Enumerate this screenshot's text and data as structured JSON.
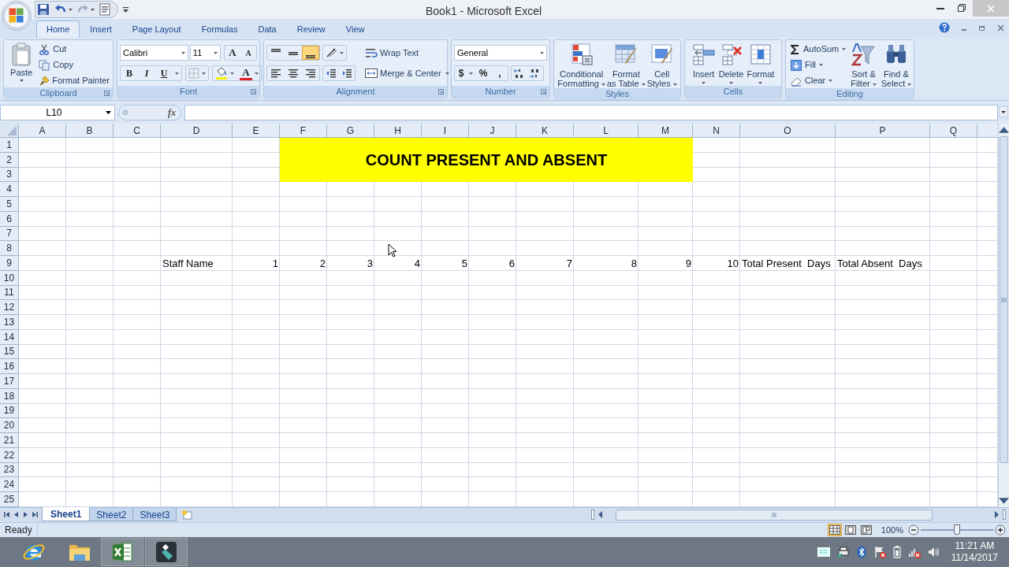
{
  "window": {
    "title": "Book1 - Microsoft Excel"
  },
  "tabs": [
    {
      "label": "Home",
      "selected": true
    },
    {
      "label": "Insert",
      "selected": false
    },
    {
      "label": "Page Layout",
      "selected": false
    },
    {
      "label": "Formulas",
      "selected": false
    },
    {
      "label": "Data",
      "selected": false
    },
    {
      "label": "Review",
      "selected": false
    },
    {
      "label": "View",
      "selected": false
    }
  ],
  "ribbon": {
    "clipboard": {
      "title": "Clipboard",
      "paste": [
        "Paste"
      ],
      "cut": "Cut",
      "copy": "Copy",
      "format_painter": "Format Painter"
    },
    "font": {
      "title": "Font",
      "font_name": "Calibri",
      "font_size": "11",
      "grow": "A",
      "shrink": "A",
      "bold": "B",
      "italic": "I",
      "underline": "U",
      "font_color": "A"
    },
    "alignment": {
      "title": "Alignment",
      "vertical_align": [
        {
          "selected": false
        },
        {
          "selected": false
        },
        {
          "selected": true
        }
      ],
      "wrap_text": "Wrap Text",
      "merge_center": "Merge & Center"
    },
    "number": {
      "title": "Number",
      "format": "General",
      "currency": "$",
      "percent": "%",
      "comma": ","
    },
    "styles": {
      "title": "Styles",
      "conditional_formatting": [
        "Conditional",
        "Formatting"
      ],
      "format_as_table": [
        "Format",
        "as Table"
      ],
      "cell_styles": [
        "Cell",
        "Styles"
      ]
    },
    "cells": {
      "title": "Cells",
      "insert": [
        "Insert"
      ],
      "delete": [
        "Delete"
      ],
      "format": [
        "Format"
      ]
    },
    "editing": {
      "title": "Editing",
      "autosum": "AutoSum",
      "fill": "Fill",
      "clear": "Clear",
      "sort_filter": [
        "Sort &",
        "Filter"
      ],
      "find_select": [
        "Find &",
        "Select"
      ]
    }
  },
  "formula_bar": {
    "name_box": "L10",
    "function_button": "fx"
  },
  "sheet": {
    "columns": [
      "A",
      "B",
      "C",
      "D",
      "E",
      "F",
      "G",
      "H",
      "I",
      "J",
      "K",
      "L",
      "M",
      "N",
      "O",
      "P",
      "Q"
    ],
    "title_banner": {
      "text": "COUNT PRESENT AND ABSENT"
    },
    "rows": [
      {
        "header": "1"
      },
      {
        "header": "2"
      },
      {
        "header": "3"
      },
      {
        "header": "4"
      },
      {
        "header": "5"
      },
      {
        "header": "6"
      },
      {
        "header": "7"
      },
      {
        "header": "8"
      },
      {
        "header": "9",
        "cells": [
          {
            "text": "Staff Name",
            "kind": "text"
          },
          {
            "text": "1",
            "kind": "number"
          },
          {
            "text": "2",
            "kind": "number"
          },
          {
            "text": "3",
            "kind": "number"
          },
          {
            "text": "4",
            "kind": "number"
          },
          {
            "text": "5",
            "kind": "number"
          },
          {
            "text": "6",
            "kind": "number"
          },
          {
            "text": "7",
            "kind": "number"
          },
          {
            "text": "8",
            "kind": "number"
          },
          {
            "text": "9",
            "kind": "number"
          },
          {
            "text": "10",
            "kind": "number"
          },
          {
            "text": "Total Present  Days",
            "kind": "text"
          },
          {
            "text": "Total Absent  Days",
            "kind": "text"
          }
        ]
      },
      {
        "header": "10"
      },
      {
        "header": "11"
      },
      {
        "header": "12"
      },
      {
        "header": "13"
      },
      {
        "header": "14"
      },
      {
        "header": "15"
      },
      {
        "header": "16"
      },
      {
        "header": "17"
      },
      {
        "header": "18"
      },
      {
        "header": "19"
      },
      {
        "header": "20"
      },
      {
        "header": "21"
      },
      {
        "header": "22"
      },
      {
        "header": "23"
      },
      {
        "header": "24"
      },
      {
        "header": "25"
      }
    ]
  },
  "sheet_tabs": [
    {
      "label": "Sheet1",
      "selected": true
    },
    {
      "label": "Sheet2",
      "selected": false
    },
    {
      "label": "Sheet3",
      "selected": false
    }
  ],
  "status_bar": {
    "status": "Ready",
    "view_buttons": [
      {
        "selected": true
      },
      {
        "selected": false
      },
      {
        "selected": false
      }
    ],
    "zoom": "100%",
    "zoom_slider": {
      "level": 0.5
    }
  },
  "taskbar": {
    "time": "11:21 AM",
    "date": "11/14/2017"
  }
}
